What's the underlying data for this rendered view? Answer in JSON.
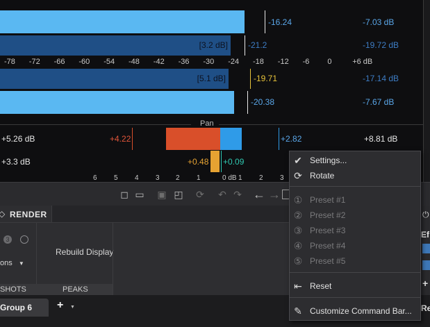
{
  "meters": {
    "top_rows": [
      {
        "value_label": "",
        "peak": "-16.24",
        "max": "-7.03 dB",
        "level_db": -24.0,
        "style": "light"
      },
      {
        "value_label": "[3.2 dB]",
        "peak": "-21.2",
        "max": "-19.72 dB",
        "level_db": -24.0,
        "style": "dark"
      }
    ],
    "scale_ticks": [
      "-78",
      "-72",
      "-66",
      "-60",
      "-54",
      "-48",
      "-42",
      "-36",
      "-30",
      "-24",
      "-18",
      "-12",
      "-6",
      "0",
      "+6 dB"
    ],
    "bottom_rows": [
      {
        "value_label": "[5.1 dB]",
        "peak": "-19.71",
        "max": "-17.14 dB",
        "level_db": -26.0,
        "style": "dark"
      },
      {
        "value_label": "",
        "peak": "-20.38",
        "max": "-7.67 dB",
        "level_db": -26.0,
        "style": "light"
      }
    ],
    "colors": {
      "light": "#5ab8f2",
      "dark": "#1f4f86",
      "peak_white": "#e9e9e9",
      "peak_yellow": "#e6c23a",
      "max_blue": "#5aa6e8"
    }
  },
  "pan": {
    "title": "Pan",
    "row1": {
      "left_total": "+5.26 dB",
      "left_peak": "+4.22",
      "right_peak": "+2.82",
      "right_total": "+8.81 dB"
    },
    "row2": {
      "left_total": "+3.3 dB",
      "left_peak": "+0.48",
      "right_peak": "+0.09"
    },
    "scale": [
      "6",
      "5",
      "4",
      "3",
      "2",
      "1",
      "0 dB",
      "1",
      "2",
      "3"
    ],
    "colors": {
      "left": "#d94f2a",
      "right": "#2f9be8",
      "left_small": "#e5a232",
      "right_small": "#2fc7b0"
    }
  },
  "toolbar": {
    "icons": [
      "add-marker-icon",
      "open-folder-icon",
      "export-icon",
      "import-icon",
      "refresh-icon",
      "undo-icon",
      "redo-icon",
      "back-arrow-icon",
      "forward-arrow-icon"
    ]
  },
  "tabs": {
    "render": "RENDER"
  },
  "panel": {
    "rebuild": "Rebuild Display",
    "options_label": "ons",
    "snapshots_label": "SHOTS",
    "peaks_label": "PEAKS",
    "right_label_1": "Ef",
    "right_label_2": "Re"
  },
  "bottom": {
    "group_tab": "Group 6"
  },
  "context_menu": {
    "settings": "Settings...",
    "rotate": "Rotate",
    "preset1": "Preset #1",
    "preset2": "Preset #2",
    "preset3": "Preset #3",
    "preset4": "Preset #4",
    "preset5": "Preset #5",
    "reset": "Reset",
    "customize": "Customize Command Bar..."
  }
}
